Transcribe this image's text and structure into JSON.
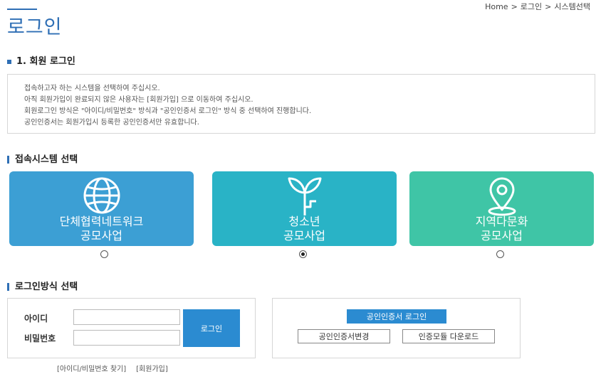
{
  "breadcrumb": {
    "home": "Home",
    "sep": ">",
    "item1": "로그인",
    "item2": "시스템선택"
  },
  "page_title": "로그인",
  "section1": {
    "title": "1. 회원 로그인",
    "info": [
      "접속하고자 하는 시스템을 선택하여 주십시오.",
      "아직 회원가입이 완료되지 않은 사용자는 [회원가입] 으로 이동하여 주십시오.",
      "회원로그인 방식은 \"아이디/비밀번호\" 방식과 \"공인인증서 로그인\" 방식 중 선택하여 진행합니다.",
      "공인인증서는 회원가입시 등록한 공인인증서만 유효합니다."
    ]
  },
  "system_select": {
    "title": "접속시스템 선택",
    "cards": [
      {
        "line1": "단체협력네트워크",
        "line2": "공모사업",
        "icon": "globe-icon",
        "color": "#3c9fd4",
        "selected": false
      },
      {
        "line1": "청소년",
        "line2": "공모사업",
        "icon": "sprout-icon",
        "color": "#29b3c6",
        "selected": true
      },
      {
        "line1": "지역다문화",
        "line2": "공모사업",
        "icon": "map-pin-icon",
        "color": "#3fc5a6",
        "selected": false
      }
    ]
  },
  "login_method": {
    "title": "로그인방식 선택",
    "id_label": "아이디",
    "pw_label": "비밀번호",
    "login_button": "로그인",
    "cert_login_button": "공인인증서 로그인",
    "cert_change_button": "공인인증서변경",
    "module_download_button": "인증모듈 다운로드"
  },
  "links": {
    "find": "[아이디/비밀번호 찾기]",
    "join": "[회원가입]"
  },
  "colors": {
    "accent": "#2f6fb5",
    "button": "#2b8bd1"
  }
}
